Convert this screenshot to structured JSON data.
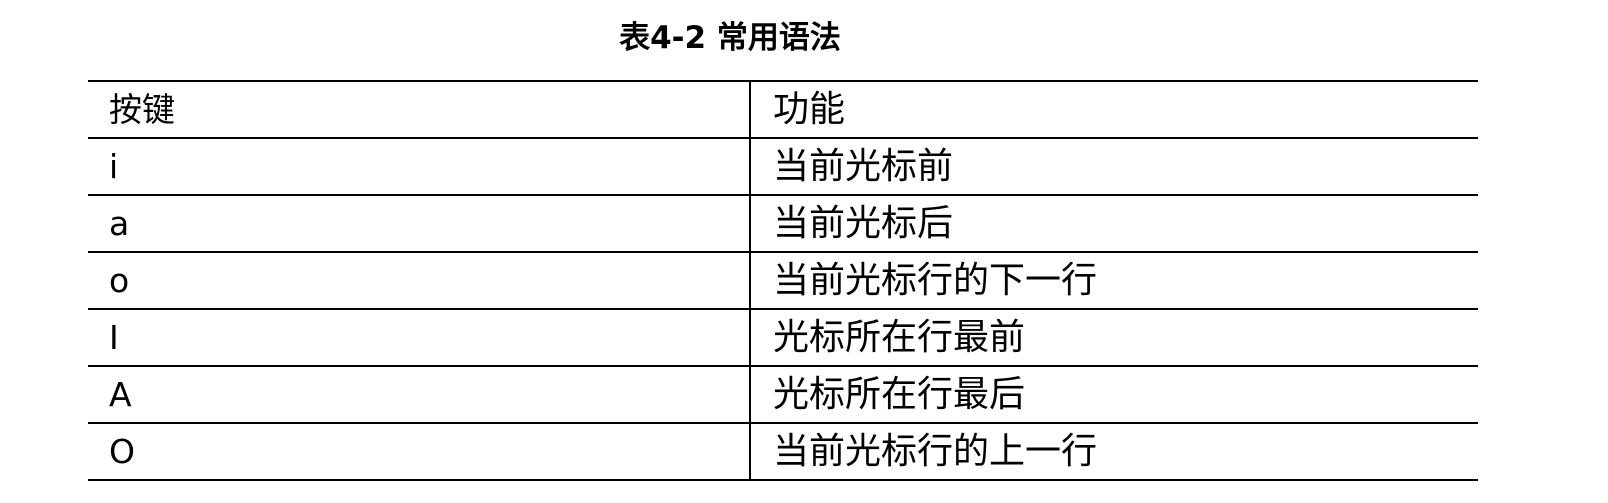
{
  "caption": "表4-2 常用语法",
  "table": {
    "header": [
      "按键",
      "功能"
    ],
    "rows": [
      [
        "i",
        "当前光标前"
      ],
      [
        "a",
        "当前光标后"
      ],
      [
        "o",
        "当前光标行的下一行"
      ],
      [
        "I",
        "光标所在行最前"
      ],
      [
        "A",
        "光标所在行最后"
      ],
      [
        "O",
        "当前光标行的上一行"
      ]
    ]
  }
}
